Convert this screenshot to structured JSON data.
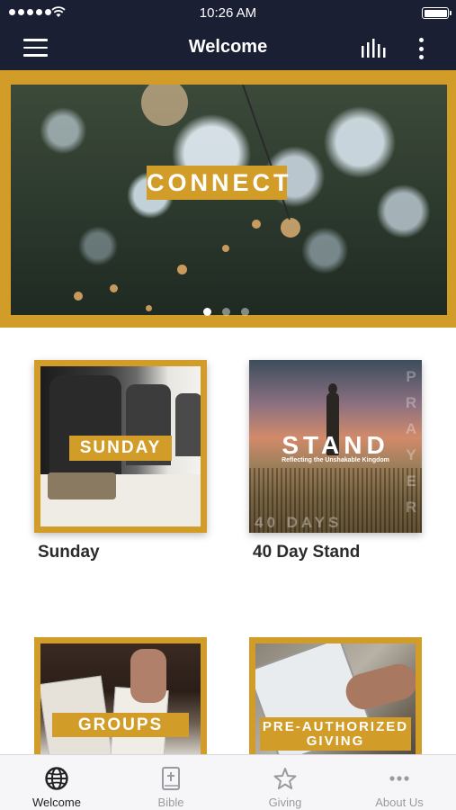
{
  "status": {
    "time": "10:26 AM"
  },
  "nav": {
    "title": "Welcome"
  },
  "hero": {
    "label": "CONNECT",
    "pages": 3,
    "active_page": 1
  },
  "cards": [
    {
      "label": "SUNDAY",
      "caption": "Sunday"
    },
    {
      "label": "STAND",
      "sublabel": "Reflecting the Unshakable Kingdom",
      "overlay": "40 DAYS",
      "side": "PRAYER",
      "caption": "40 Day Stand"
    },
    {
      "label": "GROUPS",
      "caption": ""
    },
    {
      "label_line1": "PRE-AUTHORIZED",
      "label_line2": "GIVING",
      "caption": ""
    }
  ],
  "tabs": [
    {
      "label": "Welcome",
      "icon": "globe-icon",
      "active": true
    },
    {
      "label": "Bible",
      "icon": "bible-icon",
      "active": false
    },
    {
      "label": "Giving",
      "icon": "star-icon",
      "active": false
    },
    {
      "label": "About Us",
      "icon": "ellipsis-icon",
      "active": false
    }
  ],
  "colors": {
    "navy": "#1b1f33",
    "gold": "#d19d28",
    "tab_active": "#222222",
    "tab_inactive": "#9a9aa0"
  }
}
